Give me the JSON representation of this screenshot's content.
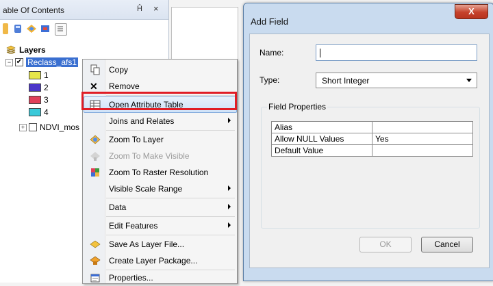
{
  "toc": {
    "title": "able Of Contents",
    "pin": "Ĥ",
    "close": "×",
    "root_label": "Layers",
    "layer1_label": "Reclass_afs1",
    "legend": [
      {
        "label": "1",
        "color": "#e6e64a"
      },
      {
        "label": "2",
        "color": "#4b35c9"
      },
      {
        "label": "3",
        "color": "#e0405a"
      },
      {
        "label": "4",
        "color": "#39c9d9"
      }
    ],
    "layer2_label": "NDVI_mos"
  },
  "menu": {
    "copy": "Copy",
    "remove": "Remove",
    "open_attribute_table": "Open Attribute Table",
    "joins_and_relates": "Joins and Relates",
    "zoom_to_layer": "Zoom To Layer",
    "zoom_to_make_visible": "Zoom To Make Visible",
    "zoom_to_raster_resolution": "Zoom To Raster Resolution",
    "visible_scale_range": "Visible Scale Range",
    "data": "Data",
    "edit_features": "Edit Features",
    "save_as_layer_file": "Save As Layer File...",
    "create_layer_package": "Create Layer Package...",
    "properties": "Properties..."
  },
  "dialog": {
    "title": "Add Field",
    "close": "X",
    "name_label": "Name:",
    "name_value": "",
    "type_label": "Type:",
    "type_value": "Short Integer",
    "field_properties_label": "Field Properties",
    "properties": [
      {
        "key": "Alias",
        "value": ""
      },
      {
        "key": "Allow NULL Values",
        "value": "Yes"
      },
      {
        "key": "Default Value",
        "value": ""
      }
    ],
    "ok": "OK",
    "cancel": "Cancel"
  },
  "colors": {
    "highlight_box": "#e01d25",
    "selection": "#3a6fd0",
    "dialog_frame": "#c9dbef"
  }
}
